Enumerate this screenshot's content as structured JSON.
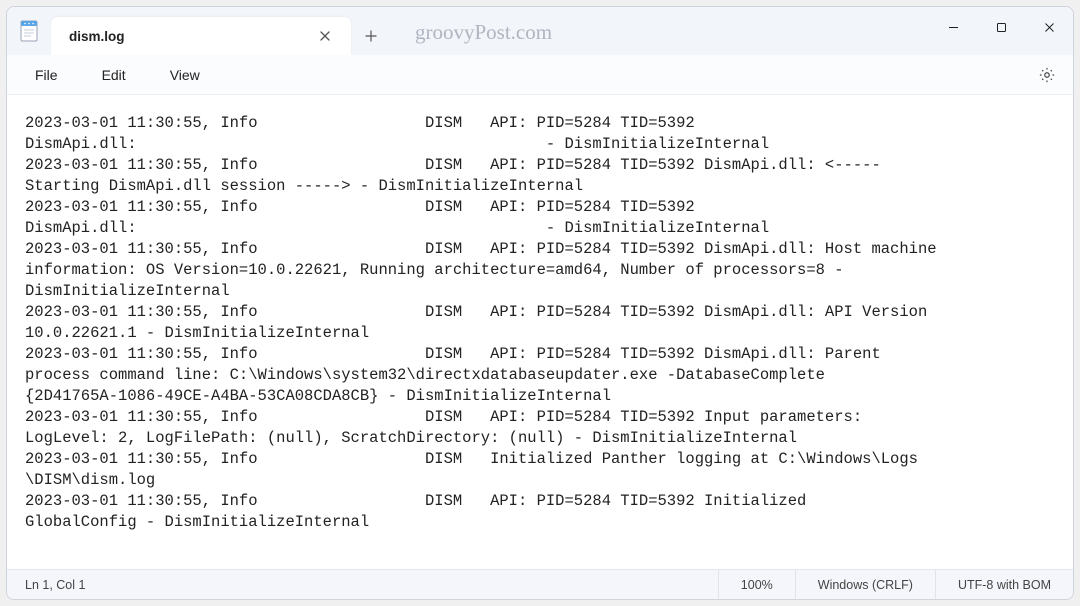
{
  "tab": {
    "title": "dism.log"
  },
  "watermark": "groovyPost.com",
  "menu": {
    "file": "File",
    "edit": "Edit",
    "view": "View"
  },
  "log_lines": [
    "2023-03-01 11:30:55, Info                  DISM   API: PID=5284 TID=5392",
    "DismApi.dll:                                            - DismInitializeInternal",
    "2023-03-01 11:30:55, Info                  DISM   API: PID=5284 TID=5392 DismApi.dll: <-----",
    "Starting DismApi.dll session -----> - DismInitializeInternal",
    "2023-03-01 11:30:55, Info                  DISM   API: PID=5284 TID=5392",
    "DismApi.dll:                                            - DismInitializeInternal",
    "2023-03-01 11:30:55, Info                  DISM   API: PID=5284 TID=5392 DismApi.dll: Host machine",
    "information: OS Version=10.0.22621, Running architecture=amd64, Number of processors=8 -",
    "DismInitializeInternal",
    "2023-03-01 11:30:55, Info                  DISM   API: PID=5284 TID=5392 DismApi.dll: API Version",
    "10.0.22621.1 - DismInitializeInternal",
    "2023-03-01 11:30:55, Info                  DISM   API: PID=5284 TID=5392 DismApi.dll: Parent",
    "process command line: C:\\Windows\\system32\\directxdatabaseupdater.exe -DatabaseComplete",
    "{2D41765A-1086-49CE-A4BA-53CA08CDA8CB} - DismInitializeInternal",
    "2023-03-01 11:30:55, Info                  DISM   API: PID=5284 TID=5392 Input parameters:",
    "LogLevel: 2, LogFilePath: (null), ScratchDirectory: (null) - DismInitializeInternal",
    "2023-03-01 11:30:55, Info                  DISM   Initialized Panther logging at C:\\Windows\\Logs",
    "\\DISM\\dism.log",
    "2023-03-01 11:30:55, Info                  DISM   API: PID=5284 TID=5392 Initialized",
    "GlobalConfig - DismInitializeInternal"
  ],
  "status": {
    "cursor": "Ln 1, Col 1",
    "zoom": "100%",
    "line_ending": "Windows (CRLF)",
    "encoding": "UTF-8 with BOM"
  }
}
